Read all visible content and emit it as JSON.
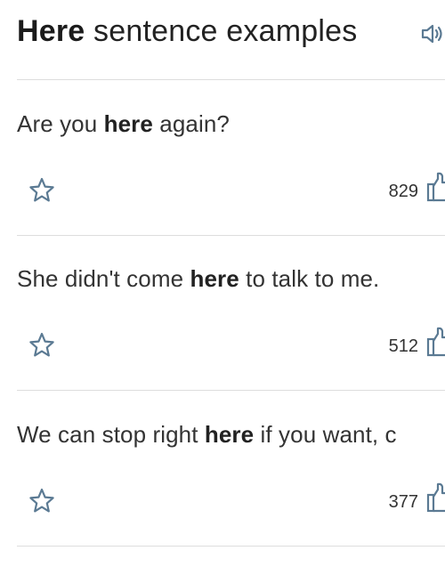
{
  "header": {
    "title_keyword": "Here",
    "title_rest": " sentence examples",
    "audio_icon": "speaker-icon"
  },
  "examples": [
    {
      "before": "Are you ",
      "keyword": "here",
      "after": " again?",
      "votes": "829"
    },
    {
      "before": "She didn't come ",
      "keyword": "here",
      "after": " to talk to me.",
      "votes": "512"
    },
    {
      "before": "We can stop right ",
      "keyword": "here",
      "after": " if you want, c",
      "votes": "377"
    }
  ],
  "icons": {
    "favorite": "star-icon",
    "vote": "thumbs-up-icon"
  },
  "colors": {
    "icon_blue": "#5b7a93",
    "divider": "#dddddd",
    "text": "#333333"
  }
}
